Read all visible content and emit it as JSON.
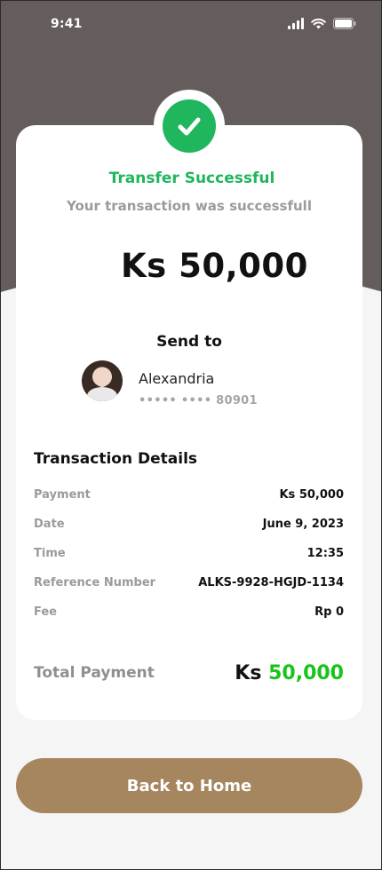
{
  "status_bar": {
    "time": "9:41"
  },
  "success": {
    "title": "Transfer Successful",
    "subtitle": "Your transaction was successfull",
    "amount": "Ks 50,000"
  },
  "recipient": {
    "heading": "Send to",
    "name": "Alexandria",
    "account": "••••• •••• 80901"
  },
  "details": {
    "title": "Transaction Details",
    "rows": [
      {
        "label": "Payment",
        "value": "Ks 50,000"
      },
      {
        "label": "Date",
        "value": "June 9, 2023"
      },
      {
        "label": "Time",
        "value": "12:35"
      },
      {
        "label": "Reference Number",
        "value": "ALKS-9928-HGJD-1134"
      },
      {
        "label": "Fee",
        "value": "Rp 0"
      }
    ],
    "total_label": "Total Payment",
    "total_currency": "Ks",
    "total_amount": "50,000"
  },
  "actions": {
    "back_home_label": "Back to Home"
  },
  "icons": {
    "status_signal": "signal-icon",
    "status_wifi": "wifi-icon",
    "status_battery": "battery-icon",
    "success": "check-icon"
  },
  "colors": {
    "header": "#645d5b",
    "success_green": "#1fb65d",
    "total_green": "#18c31a",
    "button": "#a6865e"
  }
}
